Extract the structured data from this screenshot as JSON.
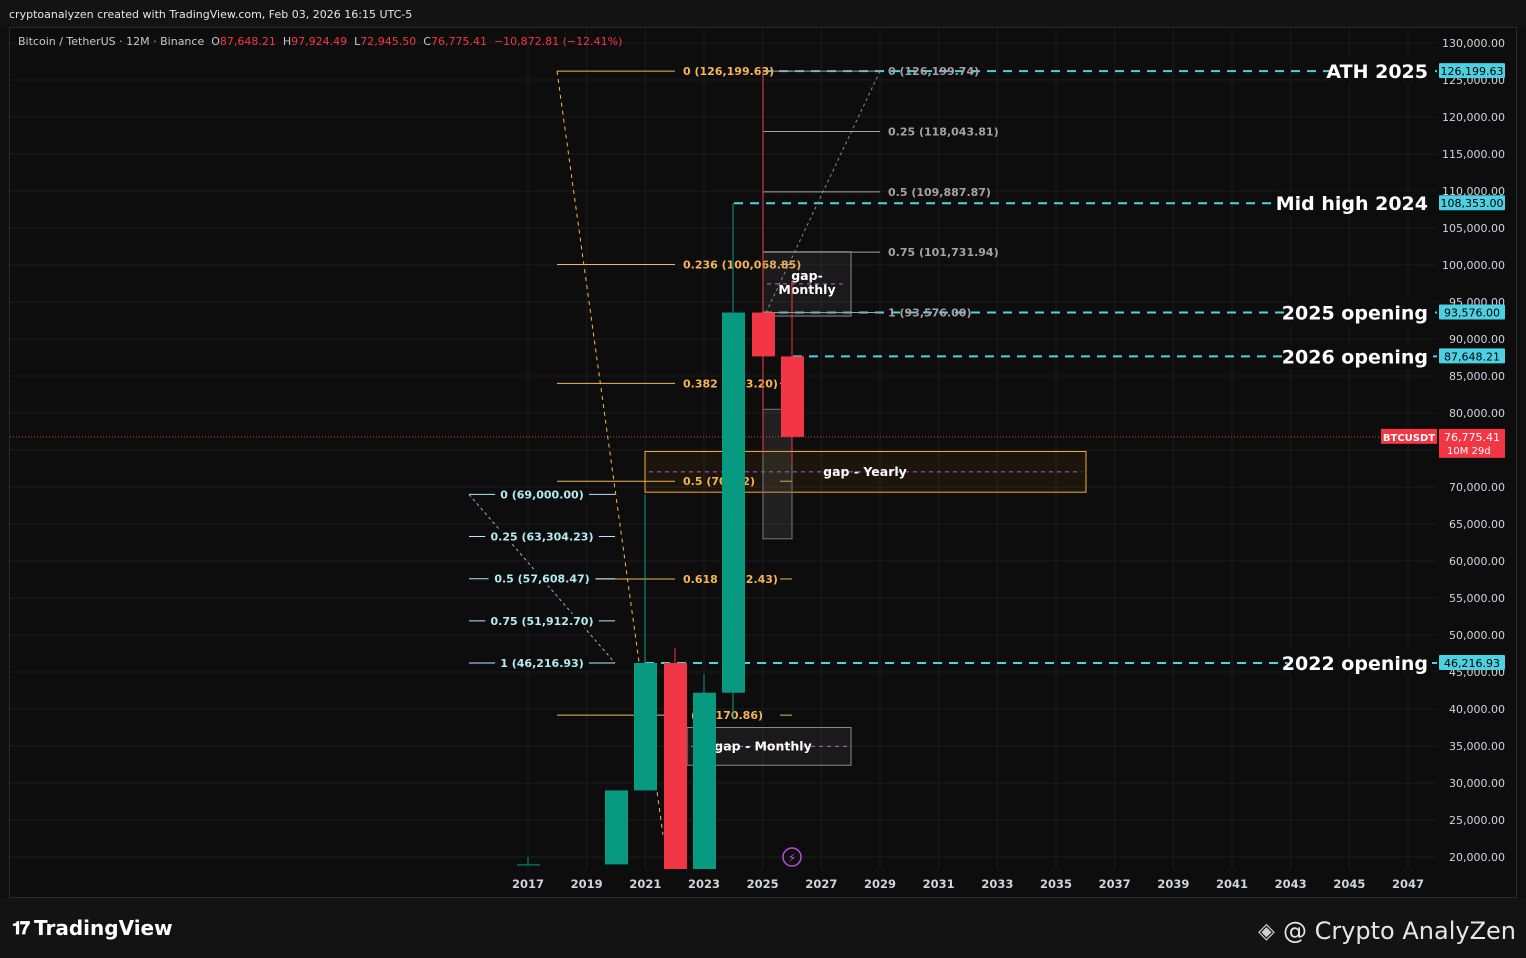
{
  "header": {
    "credit": "cryptoanalyzen created with TradingView.com, Feb 03, 2026 16:15 UTC-5"
  },
  "legend": {
    "symbol": "Bitcoin / TetherUS · 12M · Binance",
    "o_label": "O",
    "o_value": "87,648.21",
    "h_label": "H",
    "h_value": "97,924.49",
    "l_label": "L",
    "l_value": "72,945.50",
    "c_label": "C",
    "c_value": "76,775.41",
    "change": "−10,872.81 (−12.41%)"
  },
  "footer": {
    "brand": "TradingView",
    "watermark": "@ Crypto AnalyZen"
  },
  "colors": {
    "bull": "#089981",
    "bear": "#f23645",
    "level_line": "#4dd0e1",
    "fib_orange": "#f7b552",
    "fib_gray": "#a3a3a3",
    "fib_teal": "#b2ebf2"
  },
  "chart_data": {
    "type": "candlestick",
    "title": "",
    "symbol": "BTCUSDT",
    "timeframe": "12M",
    "ylim": [
      19000,
      131500
    ],
    "y_ticks": [
      "130,000.00",
      "125,000.00",
      "120,000.00",
      "115,000.00",
      "110,000.00",
      "105,000.00",
      "100,000.00",
      "95,000.00",
      "90,000.00",
      "85,000.00",
      "80,000.00",
      "75,000.00",
      "70,000.00",
      "65,000.00",
      "60,000.00",
      "55,000.00",
      "50,000.00",
      "45,000.00",
      "40,000.00",
      "35,000.00",
      "30,000.00",
      "25,000.00",
      "20,000.00"
    ],
    "x_ticks": [
      "2017",
      "2019",
      "2021",
      "2023",
      "2025",
      "2027",
      "2029",
      "2031",
      "2033",
      "2035",
      "2037",
      "2039",
      "2041",
      "2043",
      "2045",
      "2047"
    ],
    "candles": [
      {
        "year": 2017.5,
        "open": 19000,
        "high": 20000,
        "low": 19000,
        "close": 19000
      },
      {
        "year": 2020,
        "open": 19000,
        "high": 29000,
        "low": 19000,
        "close": 29000
      },
      {
        "year": 2021,
        "open": 29000,
        "high": 69000,
        "low": 29000,
        "close": 46216.93
      },
      {
        "year": 2022,
        "open": 46216.93,
        "high": 48200,
        "low": 15500,
        "close": 16500
      },
      {
        "year": 2023,
        "open": 16500,
        "high": 44700,
        "low": 16500,
        "close": 42200
      },
      {
        "year": 2024,
        "open": 42200,
        "high": 108353,
        "low": 38600,
        "close": 93576
      },
      {
        "year": 2025,
        "open": 93576,
        "high": 126199.63,
        "low": 74400,
        "close": 87648.21
      },
      {
        "year": 2026,
        "open": 87648.21,
        "high": 97924.49,
        "low": 72945.5,
        "close": 76775.41
      }
    ],
    "price_levels": [
      {
        "label": "ATH 2025",
        "price": 126199.63,
        "tag": "126,199.63"
      },
      {
        "label": "Mid high 2024",
        "price": 108353.0,
        "tag": "108,353.00"
      },
      {
        "label": "2025 opening",
        "price": 93576.0,
        "tag": "93,576.00"
      },
      {
        "label": "2026 opening",
        "price": 87648.21,
        "tag": "87,648.21"
      },
      {
        "label": "2022 opening",
        "price": 46216.93,
        "tag": "46,216.93"
      }
    ],
    "current_price": {
      "symbol": "BTCUSDT",
      "price": 76775.41,
      "tag": "76,775.41",
      "countdown": "10M 29d"
    },
    "fib_orange": [
      {
        "text": "0 (126,199.63)",
        "price": 126199.63
      },
      {
        "text": "0.236 (100,068.85)",
        "price": 100068.85
      },
      {
        "text": "0.382 (8  03.20)",
        "price": 84003.2
      },
      {
        "text": "0.5 (70  .82)",
        "price": 70780.82
      },
      {
        "text": "0.618 (5  72.43)",
        "price": 57572.43
      },
      {
        "text": ". (39,170.86)",
        "price": 39170.86
      }
    ],
    "fib_gray": [
      {
        "text": "0 (126,199.74)",
        "price": 126199.74
      },
      {
        "text": "0.25 (118,043.81)",
        "price": 118043.81
      },
      {
        "text": "0.5 (109,887.87)",
        "price": 109887.87
      },
      {
        "text": "0.75 (101,731.94)",
        "price": 101731.94
      },
      {
        "text": "1 (93,576.00)",
        "price": 93576.0
      }
    ],
    "fib_teal": [
      {
        "text": "0 (69,000.00)",
        "price": 69000.0
      },
      {
        "text": "0.25 (63,304.23)",
        "price": 63304.23
      },
      {
        "text": "0.5 (57,608.47)",
        "price": 57608.47
      },
      {
        "text": "0.75 (51,912.70)",
        "price": 51912.7
      },
      {
        "text": "1 (46,216.93)",
        "price": 46216.93
      }
    ],
    "annotations": [
      {
        "text": "gap- Monthly",
        "top": 101800,
        "bottom": 93100,
        "text_lines": [
          "gap-",
          "Monthly"
        ]
      },
      {
        "text": "gap - Yearly",
        "top": 74800,
        "bottom": 69300
      },
      {
        "text": "gap - Monthly",
        "top": 37500,
        "bottom": 32400
      }
    ]
  }
}
